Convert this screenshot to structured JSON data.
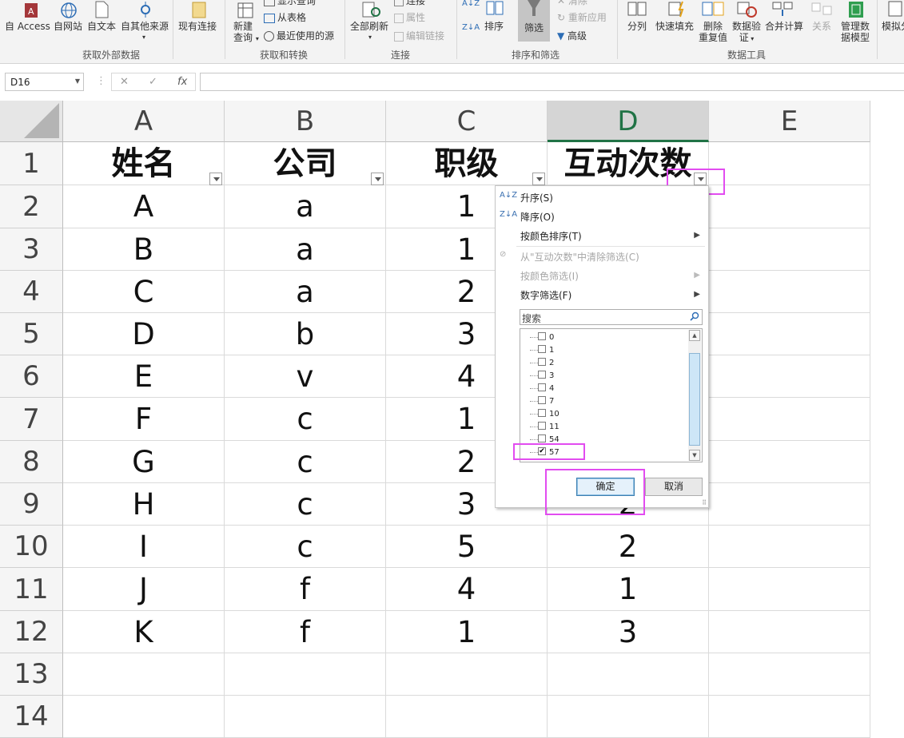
{
  "ribbon": {
    "groups": [
      {
        "name": "获取外部数据",
        "buttons": [
          "自 Access",
          "自网站",
          "自文本",
          "自其他来源",
          "现有连接"
        ]
      },
      {
        "name": "获取和转换",
        "buttons": [
          "新建",
          "查询",
          "显示查询",
          "从表格",
          "最近使用的源"
        ]
      },
      {
        "name": "连接",
        "buttons": [
          "全部刷新",
          "连接",
          "属性",
          "编辑链接"
        ]
      },
      {
        "name": "排序和筛选",
        "buttons": [
          "排序",
          "筛选",
          "清除",
          "重新应用",
          "高级"
        ]
      },
      {
        "name": "数据工具",
        "buttons": [
          "分列",
          "快速填充",
          "删除",
          "重复值",
          "数据验",
          "证",
          "合并计算",
          "关系",
          "管理数",
          "据模型"
        ]
      },
      {
        "name": "",
        "buttons": [
          "模拟分"
        ]
      }
    ]
  },
  "formula_bar": {
    "name_box": "D16",
    "cancel": "✕",
    "enter": "✓",
    "fx": "fx",
    "formula": ""
  },
  "columns": [
    "A",
    "B",
    "C",
    "D",
    "E"
  ],
  "row_numbers": [
    "1",
    "2",
    "3",
    "4",
    "5",
    "6",
    "7",
    "8",
    "9",
    "10",
    "11",
    "12",
    "13",
    "14"
  ],
  "header_row": [
    "姓名",
    "公司",
    "职级",
    "互动次数"
  ],
  "rows": [
    [
      "A",
      "a",
      "1",
      ""
    ],
    [
      "B",
      "a",
      "1",
      ""
    ],
    [
      "C",
      "a",
      "2",
      ""
    ],
    [
      "D",
      "b",
      "3",
      ""
    ],
    [
      "E",
      "v",
      "4",
      ""
    ],
    [
      "F",
      "c",
      "1",
      ""
    ],
    [
      "G",
      "c",
      "2",
      ""
    ],
    [
      "H",
      "c",
      "3",
      "2"
    ],
    [
      "I",
      "c",
      "5",
      "2"
    ],
    [
      "J",
      "f",
      "4",
      "1"
    ],
    [
      "K",
      "f",
      "1",
      "3"
    ]
  ],
  "filter_menu": {
    "sort_asc": "升序(S)",
    "sort_desc": "降序(O)",
    "sort_by_color": "按颜色排序(T)",
    "clear_filter": "从\"互动次数\"中清除筛选(C)",
    "filter_by_color": "按颜色筛选(I)",
    "number_filters": "数字筛选(F)",
    "search_placeholder": "搜索",
    "values": [
      {
        "label": "0",
        "checked": false
      },
      {
        "label": "1",
        "checked": false
      },
      {
        "label": "2",
        "checked": false
      },
      {
        "label": "3",
        "checked": false
      },
      {
        "label": "4",
        "checked": false
      },
      {
        "label": "7",
        "checked": false
      },
      {
        "label": "10",
        "checked": false
      },
      {
        "label": "11",
        "checked": false
      },
      {
        "label": "54",
        "checked": false
      },
      {
        "label": "57",
        "checked": true
      }
    ],
    "ok": "确定",
    "cancel": "取消"
  },
  "colors": {
    "accent_green": "#217346",
    "highlight": "#e24cf0"
  }
}
